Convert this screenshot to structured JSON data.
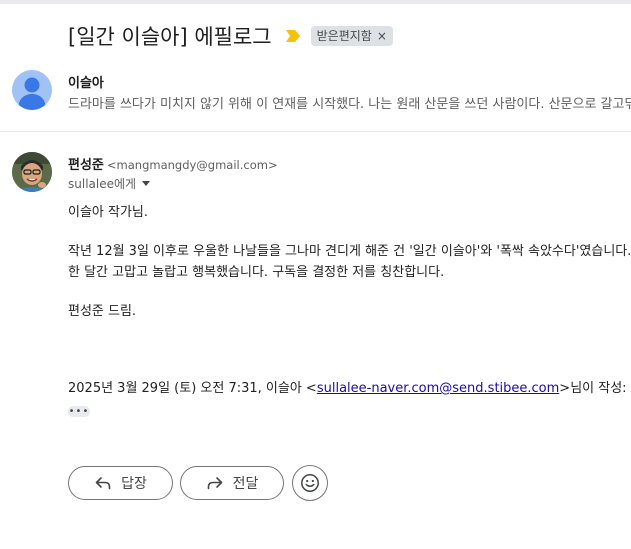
{
  "thread": {
    "subject": "[일간 이슬아] 에필로그",
    "label": "받은편지함",
    "label_remove": "×"
  },
  "collapsed_message": {
    "sender": "이슬아",
    "snippet": "드라마를 쓰다가 미치지 않기 위해 이 연재를 시작했다. 나는 원래 산문을 쓰던 사람이다. 산문으로 갈고닦"
  },
  "message": {
    "sender_name": "편성준",
    "sender_email": "<mangmangdy@gmail.com>",
    "recipient": "sullalee에게",
    "body": [
      "이슬아 작가님.",
      "작년 12월 3일 이후로 우울한 나날들을 그나마 견디게 해준 건 '일간 이슬아'와 '폭싹 속았수다'였습니다.",
      "한 달간 고맙고 놀랍고 행복했습니다. 구독을 결정한 저를 칭찬합니다.",
      "편성준 드림."
    ],
    "quote_prefix": "2025년 3월 29일 (토) 오전 7:31, 이슬아 <",
    "quote_link": "sullalee-naver.com@send.stibee.com",
    "quote_suffix": ">님이 작성:",
    "ellipsis": "•••"
  },
  "actions": {
    "reply": "답장",
    "forward": "전달"
  },
  "colors": {
    "importance_marker": "#f4c20d",
    "label_chip_bg": "#dde1e5",
    "link": "#1a0dab",
    "avatar_default": "#a0c2f5"
  }
}
